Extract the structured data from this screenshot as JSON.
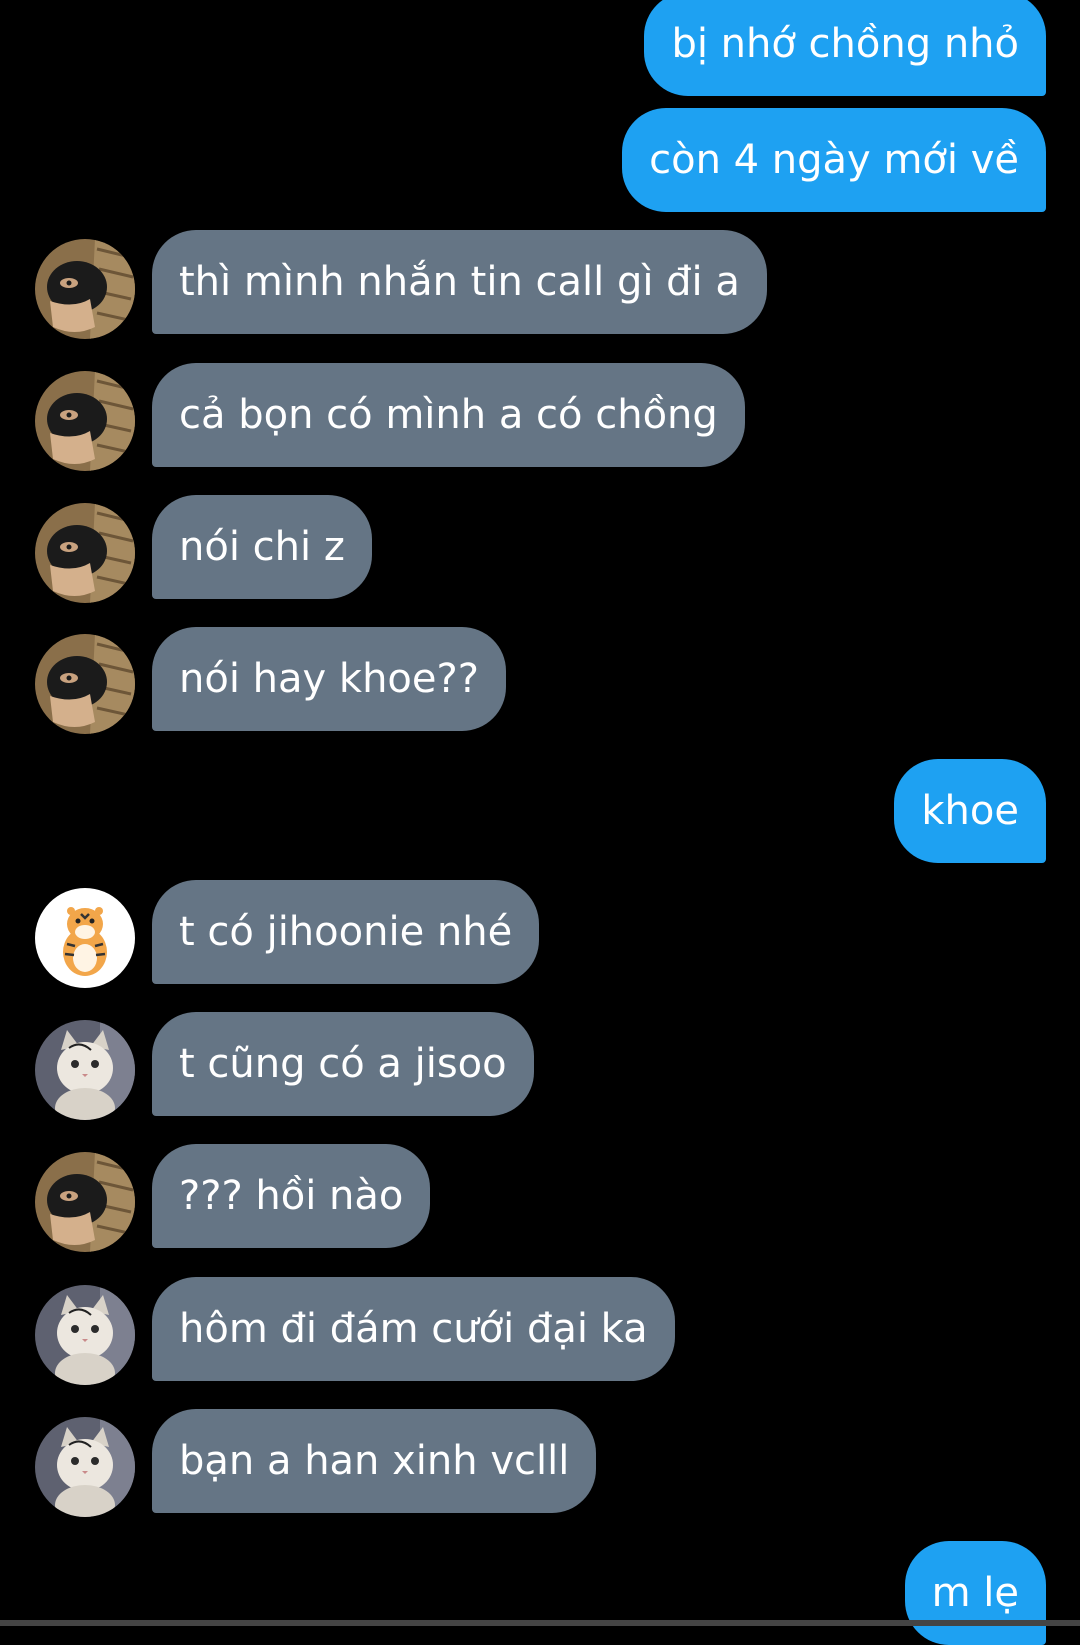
{
  "messages": [
    {
      "side": "sent",
      "text": "bị nhớ chồng nhỏ"
    },
    {
      "side": "sent",
      "text": "còn 4 ngày mới về"
    },
    {
      "side": "recv",
      "avatar": "masked-man-avatar",
      "text": "thì mình nhắn tin call gì đi a"
    },
    {
      "side": "recv",
      "avatar": "masked-man-avatar",
      "text": "cả bọn có mình a có chồng"
    },
    {
      "side": "recv",
      "avatar": "masked-man-avatar",
      "text": "nói chi z"
    },
    {
      "side": "recv",
      "avatar": "masked-man-avatar",
      "text": "nói hay khoe??"
    },
    {
      "side": "sent",
      "text": "khoe"
    },
    {
      "side": "recv",
      "avatar": "tiger-avatar",
      "text": "t có jihoonie nhé"
    },
    {
      "side": "recv",
      "avatar": "cat-avatar",
      "text": "t cũng có a jisoo"
    },
    {
      "side": "recv",
      "avatar": "masked-man-avatar",
      "text": "??? hồi nào"
    },
    {
      "side": "recv",
      "avatar": "cat-avatar",
      "text": "hôm đi đám cưới đại ka"
    },
    {
      "side": "recv",
      "avatar": "cat-avatar",
      "text": "bạn a han xinh vclll"
    },
    {
      "side": "sent",
      "text": "m lẹ"
    }
  ],
  "colors": {
    "background": "#000000",
    "sent_bubble": "#1ea1f2",
    "received_bubble": "#657585",
    "text": "#ffffff"
  }
}
